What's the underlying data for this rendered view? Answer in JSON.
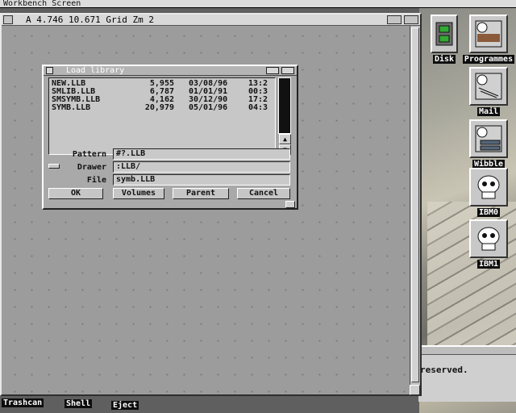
{
  "screen": {
    "title": "Workbench Screen"
  },
  "main_window": {
    "status": "A   4.746  10.671  Grid  Zm 2"
  },
  "requester": {
    "title": "Load library",
    "files": [
      {
        "name": "NEW.LLB",
        "size": "5,955",
        "date": "03/08/96",
        "time": "13:2"
      },
      {
        "name": "SMLIB.LLB",
        "size": "6,787",
        "date": "01/01/91",
        "time": "00:3"
      },
      {
        "name": "SMSYMB.LLB",
        "size": "4,162",
        "date": "30/12/90",
        "time": "17:2"
      },
      {
        "name": "SYMB.LLB",
        "size": "20,979",
        "date": "05/01/96",
        "time": "04:3"
      }
    ],
    "pattern_label": "Pattern",
    "pattern_value": "#?.LLB",
    "drawer_label": "Drawer",
    "drawer_value": ":LLB/",
    "file_label": "File",
    "file_value": "symb.LLB",
    "buttons": {
      "ok": "OK",
      "volumes": "Volumes",
      "parent": "Parent",
      "cancel": "Cancel"
    }
  },
  "desktop_icons": [
    {
      "label": "Disk",
      "icon": "disk-icon"
    },
    {
      "label": "Programmes",
      "icon": "drawer-icon"
    },
    {
      "label": "Mail",
      "icon": "drawer-icon"
    },
    {
      "label": "Wibble",
      "icon": "drawer-icon"
    },
    {
      "label": "IBM0",
      "icon": "skull-icon"
    },
    {
      "label": "IBM1",
      "icon": "skull-icon"
    }
  ],
  "bottom_icons": {
    "trashcan": "Trashcan",
    "shell": "Shell",
    "eject": "Eject"
  },
  "shell_window": {
    "text": "reserved."
  }
}
